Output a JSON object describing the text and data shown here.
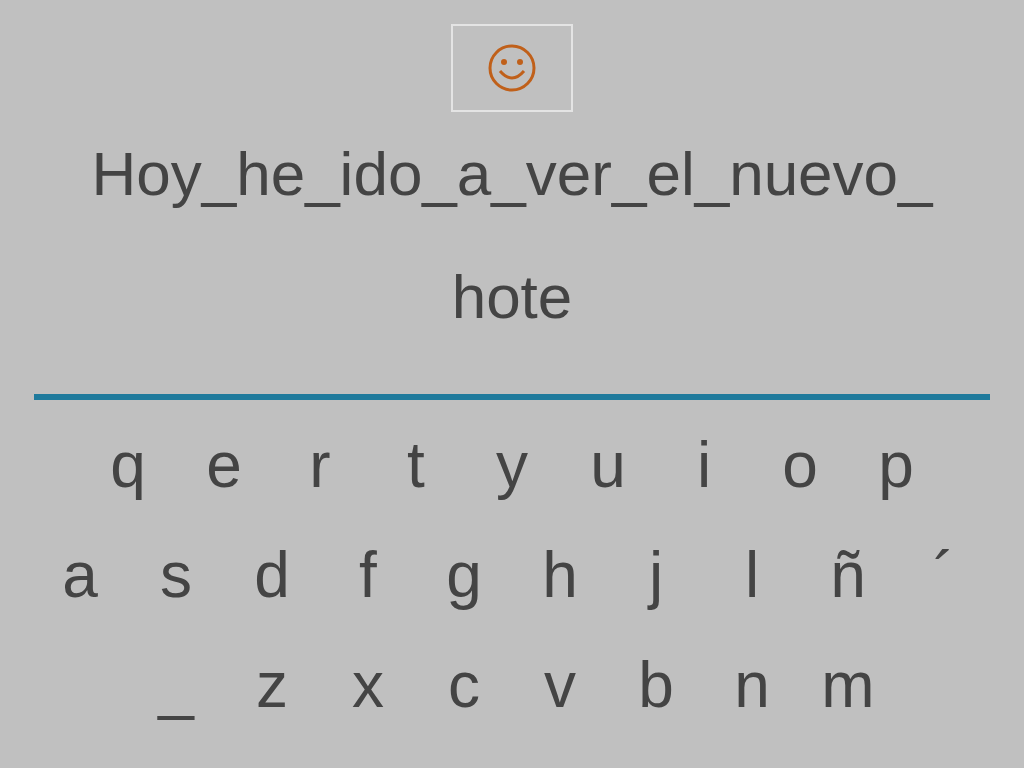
{
  "sentence": {
    "lines": [
      "Hoy_he_ido_a_ver_el_nuevo_",
      "hote"
    ]
  },
  "keyboard": {
    "rows": [
      [
        "q",
        "e",
        "r",
        "t",
        "y",
        "u",
        "i",
        "o",
        "p"
      ],
      [
        "a",
        "s",
        "d",
        "f",
        "g",
        "h",
        "j",
        "l",
        "ñ",
        "´"
      ],
      [
        "_",
        "z",
        "x",
        "c",
        "v",
        "b",
        "n",
        "m"
      ]
    ]
  }
}
